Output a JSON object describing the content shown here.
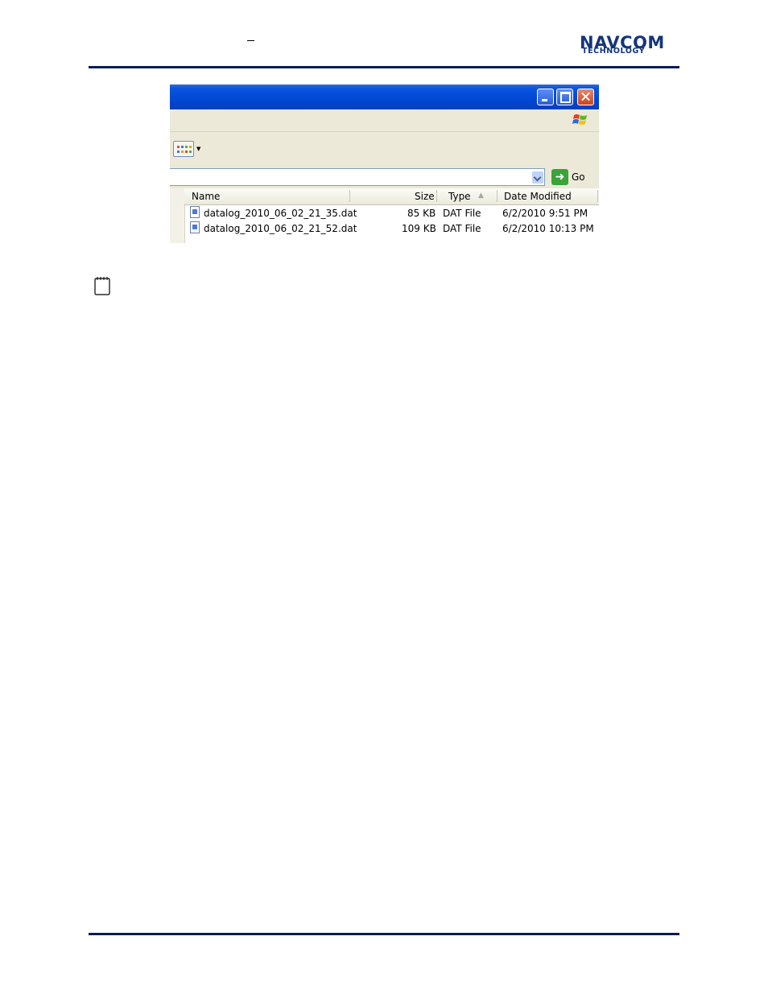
{
  "page": {
    "header_mark": "–",
    "logo": {
      "main": "NAVCOM",
      "sub": "TECHNOLOGY",
      "color": "#14357a"
    }
  },
  "screenshot": {
    "titlebar_buttons": [
      "minimize-icon",
      "maximize-icon",
      "close-icon"
    ],
    "address": {
      "value": "",
      "go_label": "Go"
    },
    "columns": {
      "name": "Name",
      "size": "Size",
      "type": "Type",
      "date": "Date Modified"
    },
    "sort_indicator": "▲",
    "files": [
      {
        "name": "datalog_2010_06_02_21_35.dat",
        "size": "85 KB",
        "type": "DAT File",
        "date": "6/2/2010 9:51 PM"
      },
      {
        "name": "datalog_2010_06_02_21_52.dat",
        "size": "109 KB",
        "type": "DAT File",
        "date": "6/2/2010 10:13 PM"
      }
    ]
  },
  "note": {
    "icon": "notepad-icon"
  }
}
